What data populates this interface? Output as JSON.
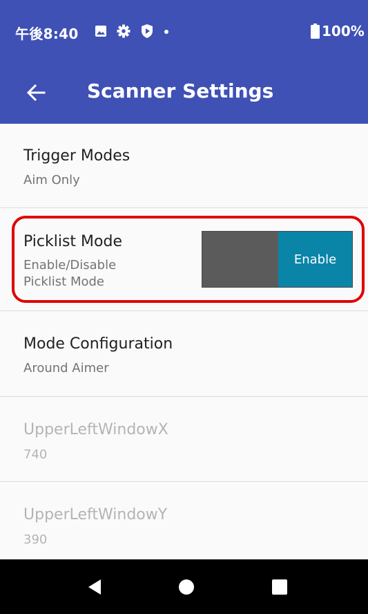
{
  "status_bar": {
    "time": "午後8:40",
    "battery": "100%",
    "icons": [
      "image-icon",
      "gear-icon",
      "shield-icon",
      "dot-icon",
      "battery-icon"
    ]
  },
  "app_bar": {
    "title": "Scanner Settings",
    "back_icon": "arrow-left-icon"
  },
  "settings": [
    {
      "title": "Trigger Modes",
      "subtitle": "Aim Only",
      "enabled": true
    },
    {
      "title": "Picklist Mode",
      "subtitle": "Enable/Disable\nPicklist Mode",
      "toggle_label": "Enable",
      "enabled": true
    },
    {
      "title": "Mode Configuration",
      "subtitle": "Around Aimer",
      "enabled": true
    },
    {
      "title": "UpperLeftWindowX",
      "subtitle": "740",
      "enabled": false
    },
    {
      "title": "UpperLeftWindowY",
      "subtitle": "390",
      "enabled": false
    }
  ],
  "nav_bar": {
    "buttons": [
      "back-triangle-icon",
      "home-circle-icon",
      "recents-square-icon"
    ]
  },
  "colors": {
    "primary": "#3f51b5",
    "toggle_on": "#0a85a8",
    "toggle_off": "#5b5b5b",
    "highlight": "#e00000"
  }
}
